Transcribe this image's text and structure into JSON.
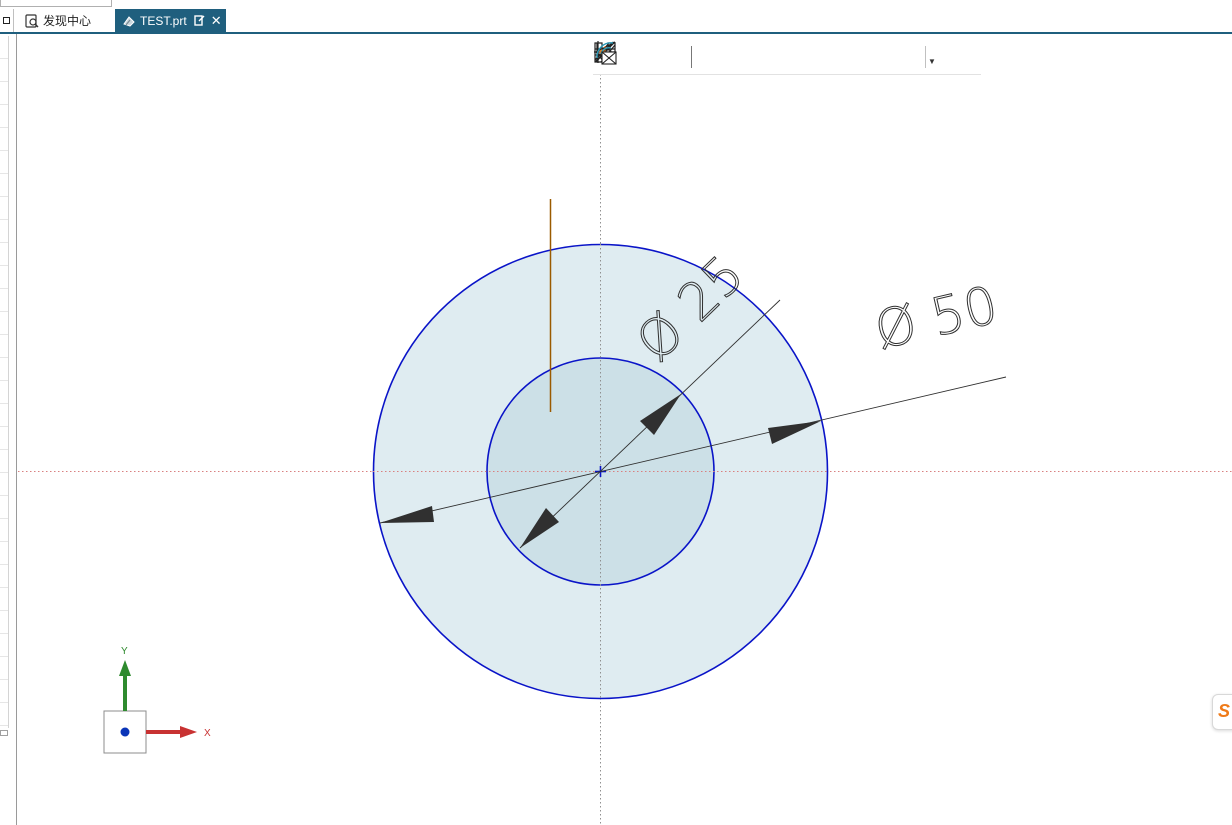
{
  "tabs": [
    {
      "label": "发现中心",
      "active": false
    },
    {
      "label": "TEST.prt",
      "active": true
    }
  ],
  "sketch": {
    "dimensions": [
      {
        "label": "Ø 25",
        "symbol": "Ø",
        "value": "25"
      },
      {
        "label": "Ø 50",
        "symbol": "Ø",
        "value": "50"
      }
    ]
  },
  "triad": {
    "x_label": "X",
    "y_label": "Y"
  },
  "toolbar_icons": [
    "coincident-icon",
    "point-on-curve-icon",
    "horizontal-icon",
    "vertical-icon",
    "tangent-icon",
    "parallel-icon",
    "perpendicular-icon",
    "equal-length-icon",
    "midpoint-icon",
    "point-on-line-icon",
    "show-constraints-icon"
  ],
  "colors": {
    "tab_active": "#1f5f7e",
    "sketch_curve": "#0a14c8",
    "circle_fill": "#cfe1e8",
    "dimension": "#303030",
    "center_line_vertical": "#909090",
    "center_line_horizontal": "#d88080",
    "reference_line": "#9a5a00",
    "axis_x": "#d03030",
    "axis_y": "#2e8a2e",
    "logo": "#ef7a18"
  },
  "logo_glyph": "S"
}
